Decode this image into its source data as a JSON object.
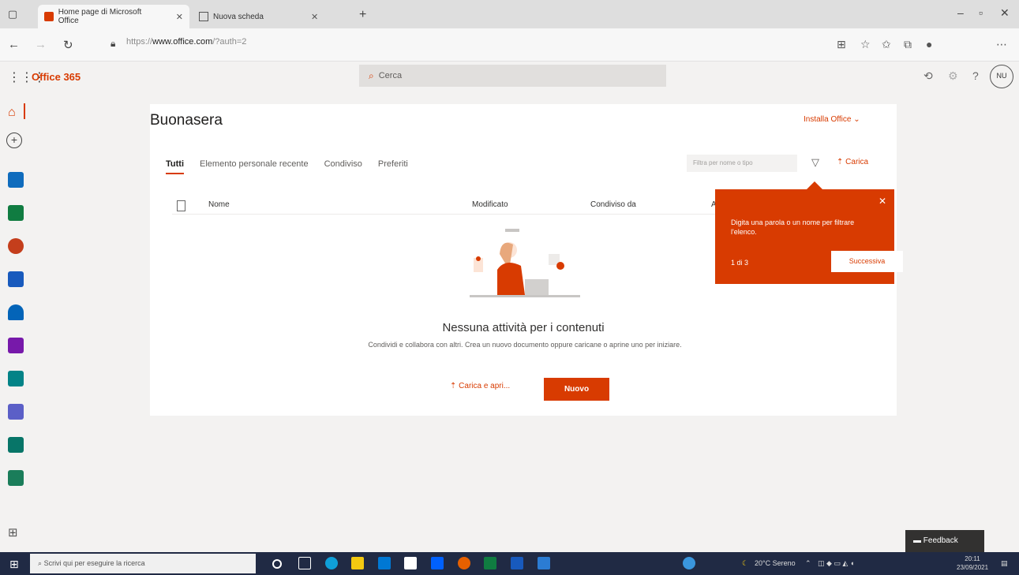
{
  "browser": {
    "tabs": [
      {
        "title": "Home page di Microsoft Office",
        "active": true
      },
      {
        "title": "Nuova scheda",
        "active": false
      }
    ],
    "url_prefix": "https://",
    "url_domain": "www.office.com",
    "url_path": "/?auth=2"
  },
  "header": {
    "app_name": "Office 365",
    "search_placeholder": "Cerca",
    "avatar_initials": "NU"
  },
  "main": {
    "greeting": "Buonasera",
    "install_label": "Installa Office",
    "pivots": [
      "Tutti",
      "Elemento personale recente",
      "Condiviso",
      "Preferiti"
    ],
    "filter_placeholder": "Filtra per nome o tipo",
    "upload_label": "Carica",
    "columns": {
      "name": "Nome",
      "modified": "Modificato",
      "shared_by": "Condiviso da",
      "activity": "A"
    },
    "empty_title": "Nessuna attività per i contenuti",
    "empty_sub": "Condividi e collabora con altri. Crea un nuovo documento oppure caricane o aprine uno per iniziare.",
    "upload_open_label": "Carica e apri...",
    "new_label": "Nuovo"
  },
  "coachmark": {
    "text": "Digita una parola o un nome per filtrare l'elenco.",
    "count": "1 di 3",
    "next_label": "Successiva"
  },
  "feedback_label": "Feedback",
  "taskbar": {
    "search_placeholder": "Scrivi qui per eseguire la ricerca",
    "weather": "20°C Sereno",
    "time": "20:11",
    "date": "23/09/2021"
  },
  "colors": {
    "accent": "#d83b01",
    "taskbar": "#202a44"
  }
}
